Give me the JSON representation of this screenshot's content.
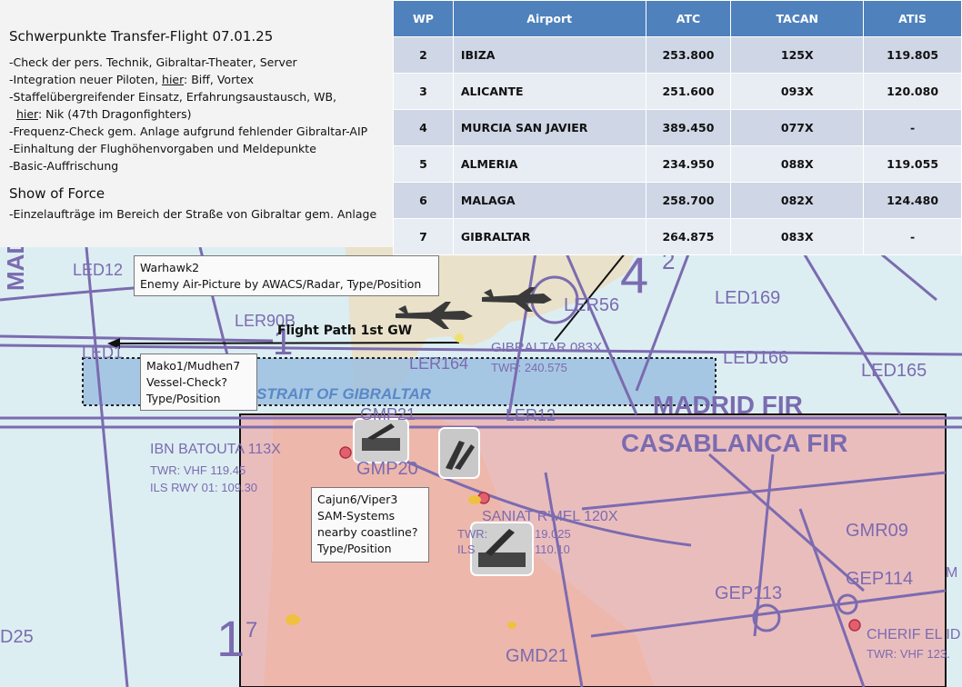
{
  "briefing": {
    "title": "Schwerpunkte Transfer-Flight 07.01.25",
    "items": [
      {
        "text": "-Check der pers. Technik, Gibraltar-Theater, Server"
      },
      {
        "pre": "-Integration neuer Piloten, ",
        "u": "hier",
        "post": ": Biff, Vortex"
      },
      {
        "text": "-Staffelübergreifender Einsatz, Erfahrungsaustausch, WB,"
      },
      {
        "pre": "  ",
        "u": "hier",
        "post": ": Nik (47th Dragonfighters)"
      },
      {
        "text": "-Frequenz-Check gem. Anlage aufgrund fehlender Gibraltar-AIP"
      },
      {
        "text": "-Einhaltung der Flughöhenvorgaben und Meldepunkte"
      },
      {
        "text": "-Basic-Auffrischung"
      }
    ],
    "section2_title": "Show of Force",
    "section2_item": "-Einzelaufträge im Bereich der Straße von Gibraltar gem. Anlage"
  },
  "waypoints": {
    "headers": [
      "WP",
      "Airport",
      "ATC",
      "TACAN",
      "ATIS"
    ],
    "rows": [
      [
        "2",
        "IBIZA",
        "253.800",
        "125X",
        "119.805"
      ],
      [
        "3",
        "ALICANTE",
        "251.600",
        "093X",
        "120.080"
      ],
      [
        "4",
        "MURCIA SAN JAVIER",
        "389.450",
        "077X",
        "-"
      ],
      [
        "5",
        "ALMERIA",
        "234.950",
        "088X",
        "119.055"
      ],
      [
        "6",
        "MALAGA",
        "258.700",
        "082X",
        "124.480"
      ],
      [
        "7",
        "GIBRALTAR",
        "264.875",
        "083X",
        "-"
      ]
    ]
  },
  "callouts": {
    "warhawk": [
      "Warhawk2",
      "Enemy Air-Picture by AWACS/Radar, Type/Position"
    ],
    "mako": [
      "Mako1/Mudhen7",
      "Vessel-Check?",
      "Type/Position"
    ],
    "cajun": [
      "Cajun6/Viper3",
      "SAM-Systems",
      "nearby coastline?",
      "Type/Position"
    ]
  },
  "map": {
    "flight_path_label": "Flight Path 1st GW",
    "labels": {
      "led12": "LED12",
      "led90b": "LER90B",
      "led1x": "LED1",
      "madrid_edge": "MAD",
      "led169": "LED169",
      "led166": "LED166",
      "led165": "LED165",
      "ler56": "LER56",
      "ler164": "LER164",
      "gibraltar": "GIBRALTAR 083X",
      "gibraltar_twr": "TWR: 240.575",
      "strait": "STRAIT OF GIBRALTAR",
      "madrid_fir": "MADRID FIR",
      "casablanca_fir": "CASABLANCA FIR",
      "gmp21": "GMP21",
      "ler12": "LER12",
      "ibn": "IBN BATOUTA 113X",
      "ibn_twr": "TWR: VHF 119.45",
      "ibn_ils": "ILS RWY 01: 109.30",
      "gmp20": "GMP20",
      "saniat": "SANIAT R'MEL 120X",
      "saniat_twr": "TWR:",
      "saniat_twr_freq": "19.025",
      "saniat_ils": "ILS",
      "saniat_ils_freq": "110.10",
      "gmr09": "GMR09",
      "gep113": "GEP113",
      "gep114": "GEP114",
      "cherif": "CHERIF EL ID",
      "cherif_twr": "TWR: VHF 123.",
      "gmd21": "GMD21",
      "d25": "D25",
      "zone_4_2_main": "4",
      "zone_4_2_sup": "2",
      "zone_1_main": "1",
      "zone_1_upper": "1",
      "zone_1_7_main": "1",
      "zone_1_7_sup": "7",
      "right_edge_m": "M"
    }
  },
  "colors": {
    "table_header": "#4f81bd",
    "row_odd": "#cfd7e6",
    "row_even": "#e8ecf3",
    "sea": "#dceef2",
    "airspace": "#7b6bb0",
    "restricted_red_fill": "#f3b3b0",
    "strait_zone": "#9cc0e0"
  }
}
